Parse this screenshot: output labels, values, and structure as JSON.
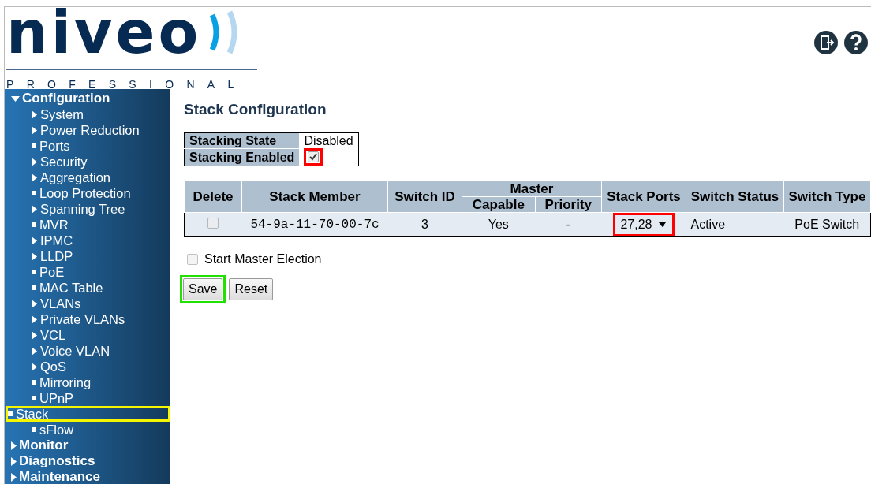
{
  "logo": {
    "wordmark": "niveo",
    "tagline": "PROFESSIONAL"
  },
  "sidebar": {
    "items": [
      {
        "label": "Configuration",
        "expanded": true,
        "children": [
          {
            "label": "System",
            "kind": "folder",
            "highlighted": false
          },
          {
            "label": "Power Reduction",
            "kind": "folder",
            "highlighted": false
          },
          {
            "label": "Ports",
            "kind": "page",
            "highlighted": false
          },
          {
            "label": "Security",
            "kind": "folder",
            "highlighted": false
          },
          {
            "label": "Aggregation",
            "kind": "folder",
            "highlighted": false
          },
          {
            "label": "Loop Protection",
            "kind": "page",
            "highlighted": false
          },
          {
            "label": "Spanning Tree",
            "kind": "folder",
            "highlighted": false
          },
          {
            "label": "MVR",
            "kind": "page",
            "highlighted": false
          },
          {
            "label": "IPMC",
            "kind": "folder",
            "highlighted": false
          },
          {
            "label": "LLDP",
            "kind": "folder",
            "highlighted": false
          },
          {
            "label": "PoE",
            "kind": "page",
            "highlighted": false
          },
          {
            "label": "MAC Table",
            "kind": "page",
            "highlighted": false
          },
          {
            "label": "VLANs",
            "kind": "folder",
            "highlighted": false
          },
          {
            "label": "Private VLANs",
            "kind": "folder",
            "highlighted": false
          },
          {
            "label": "VCL",
            "kind": "folder",
            "highlighted": false
          },
          {
            "label": "Voice VLAN",
            "kind": "folder",
            "highlighted": false
          },
          {
            "label": "QoS",
            "kind": "folder",
            "highlighted": false
          },
          {
            "label": "Mirroring",
            "kind": "page",
            "highlighted": false
          },
          {
            "label": "UPnP",
            "kind": "page",
            "highlighted": false
          },
          {
            "label": "Stack",
            "kind": "page",
            "highlighted": true
          },
          {
            "label": "sFlow",
            "kind": "page",
            "highlighted": false
          }
        ]
      },
      {
        "label": "Monitor",
        "expanded": false
      },
      {
        "label": "Diagnostics",
        "expanded": false
      },
      {
        "label": "Maintenance",
        "expanded": false
      }
    ]
  },
  "page_title": "Stack Configuration",
  "state_table": {
    "rows": [
      {
        "label": "Stacking State",
        "kind": "text",
        "value": "Disabled"
      },
      {
        "label": "Stacking Enabled",
        "kind": "checkbox",
        "checked": true,
        "highlighted": true
      }
    ]
  },
  "table": {
    "columns": [
      "Delete",
      "Stack Member",
      "Switch ID",
      "Master",
      "Stack Ports",
      "Switch Status",
      "Switch Type"
    ],
    "subcolumns": [
      "Capable",
      "Priority"
    ],
    "rows": [
      {
        "delete": false,
        "stack_member": "54-9a-11-70-00-7c",
        "switch_id": "3",
        "capable": "Yes",
        "priority": "-",
        "stack_ports": "27,28",
        "stack_ports_highlighted": true,
        "switch_status": "Active",
        "switch_type": "PoE Switch"
      }
    ]
  },
  "start_master_election": {
    "label": "Start Master Election",
    "checked": false
  },
  "buttons": [
    {
      "label": "Save",
      "highlighted": true
    },
    {
      "label": "Reset",
      "highlighted": false
    }
  ]
}
